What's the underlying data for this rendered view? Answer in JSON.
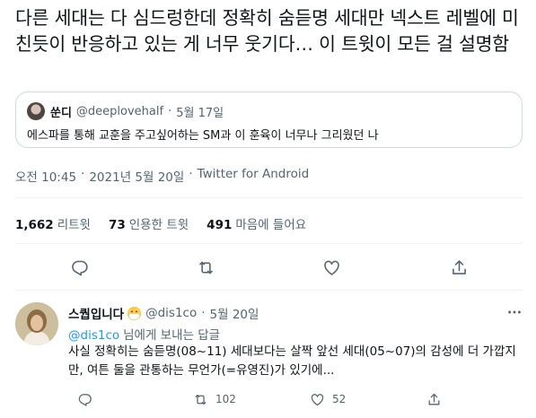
{
  "tweet": {
    "text": "다른 세대는 다 심드렁한데 정확히 숨듣명 세대만 넥스트 레벨에 미친듯이 반응하고 있는 게 너무 웃기다… 이 트윗이 모든 걸 설명함"
  },
  "quote": {
    "name": "쑨디",
    "handle": "@deeplovehalf",
    "separator": "·",
    "date": "5월 17일",
    "text": "에스파를 통해 교훈을 주고싶어하는 SM과 이 훈육이 너무나 그리웠던 나"
  },
  "meta": {
    "time": "오전 10:45",
    "separator": "·",
    "date": "2021년 5월 20일",
    "source": "Twitter for Android"
  },
  "stats": {
    "retweets_count": "1,662",
    "retweets_label": "리트윗",
    "quotes_count": "73",
    "quotes_label": "인용한 트윗",
    "likes_count": "491",
    "likes_label": "마음에 들어요"
  },
  "actions": {
    "icons": [
      "reply-icon",
      "retweet-icon",
      "like-icon",
      "share-icon"
    ]
  },
  "reply": {
    "name": "스퀍입니다",
    "handle": "@dis1co",
    "separator": "·",
    "date": "5월 20일",
    "replying_mention": "@dis1co",
    "replying_suffix": "님에게 보내는 답글",
    "text": "사실 정확히는 숨듣명(08~11) 세대보다는 살짝 앞선 세대(05~07)의 감성에 더 가깝지만, 여튼 둘을 관통하는 무언가(=유영진)가 있기에...",
    "reply_count": "",
    "retweet_count": "102",
    "like_count": "52"
  },
  "colors": {
    "text": "#0f1419",
    "secondary": "#536471",
    "accent": "#1d9bf0",
    "border": "#cfd9de",
    "divider": "#eff3f4"
  }
}
